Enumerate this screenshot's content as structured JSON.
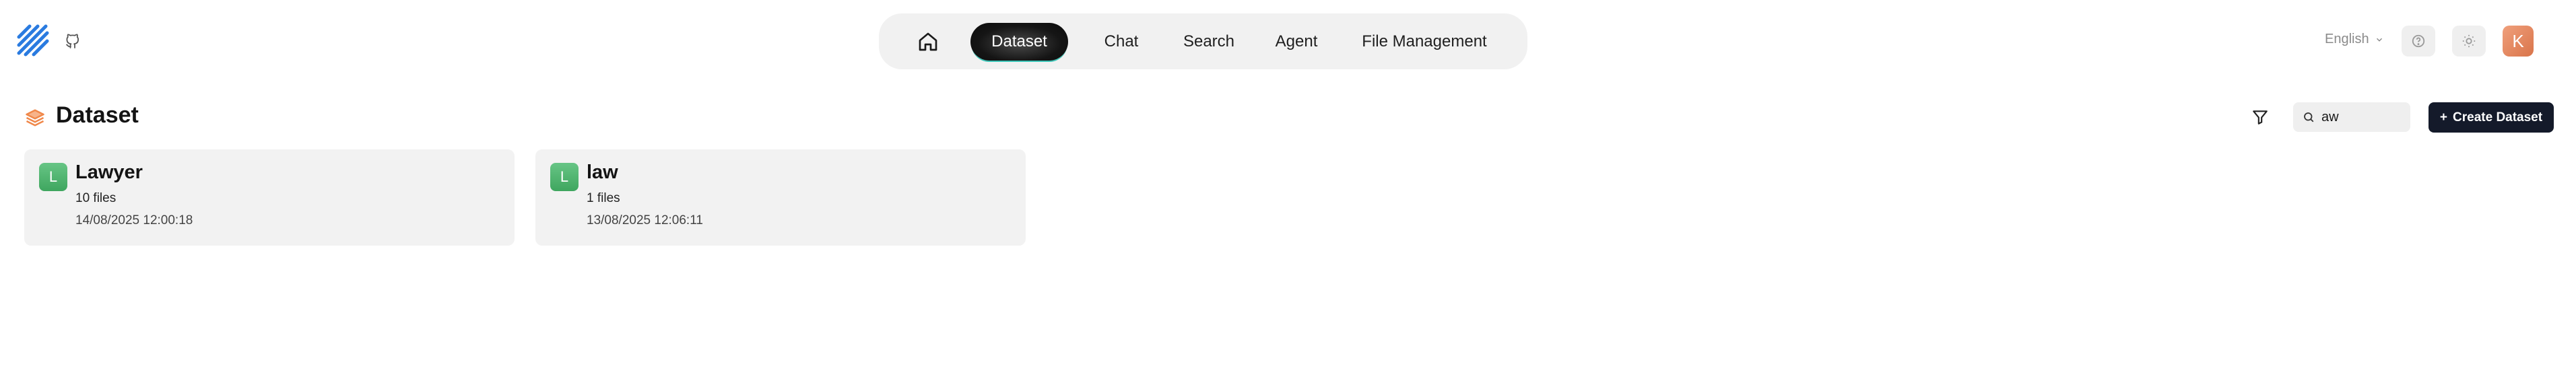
{
  "header": {
    "nav": [
      {
        "label": "Dataset",
        "active": true
      },
      {
        "label": "Chat",
        "active": false
      },
      {
        "label": "Search",
        "active": false
      },
      {
        "label": "Agent",
        "active": false
      },
      {
        "label": "File Management",
        "active": false
      }
    ],
    "language": "English",
    "avatar_initial": "K",
    "icons": {
      "logo": "stripes-logo",
      "github": "github-icon",
      "home": "home-icon",
      "help": "help-icon",
      "theme": "sun-icon"
    }
  },
  "page": {
    "title": "Dataset",
    "search_value": "aw",
    "create_label": "Create Dataset",
    "create_icon": "+"
  },
  "datasets": [
    {
      "initial": "L",
      "name": "Lawyer",
      "files": "10 files",
      "date": "14/08/2025 12:00:18"
    },
    {
      "initial": "L",
      "name": "law",
      "files": "1 files",
      "date": "13/08/2025 12:06:11"
    }
  ],
  "colors": {
    "accent_dark": "#141a2a",
    "nav_active": "#151515",
    "card_bg": "#f2f2f2",
    "avatar_orange": "#e07c52",
    "dataset_green": "#4fb56e",
    "logo_blue": "#2a7be0",
    "title_icon_orange": "#f0884a"
  }
}
